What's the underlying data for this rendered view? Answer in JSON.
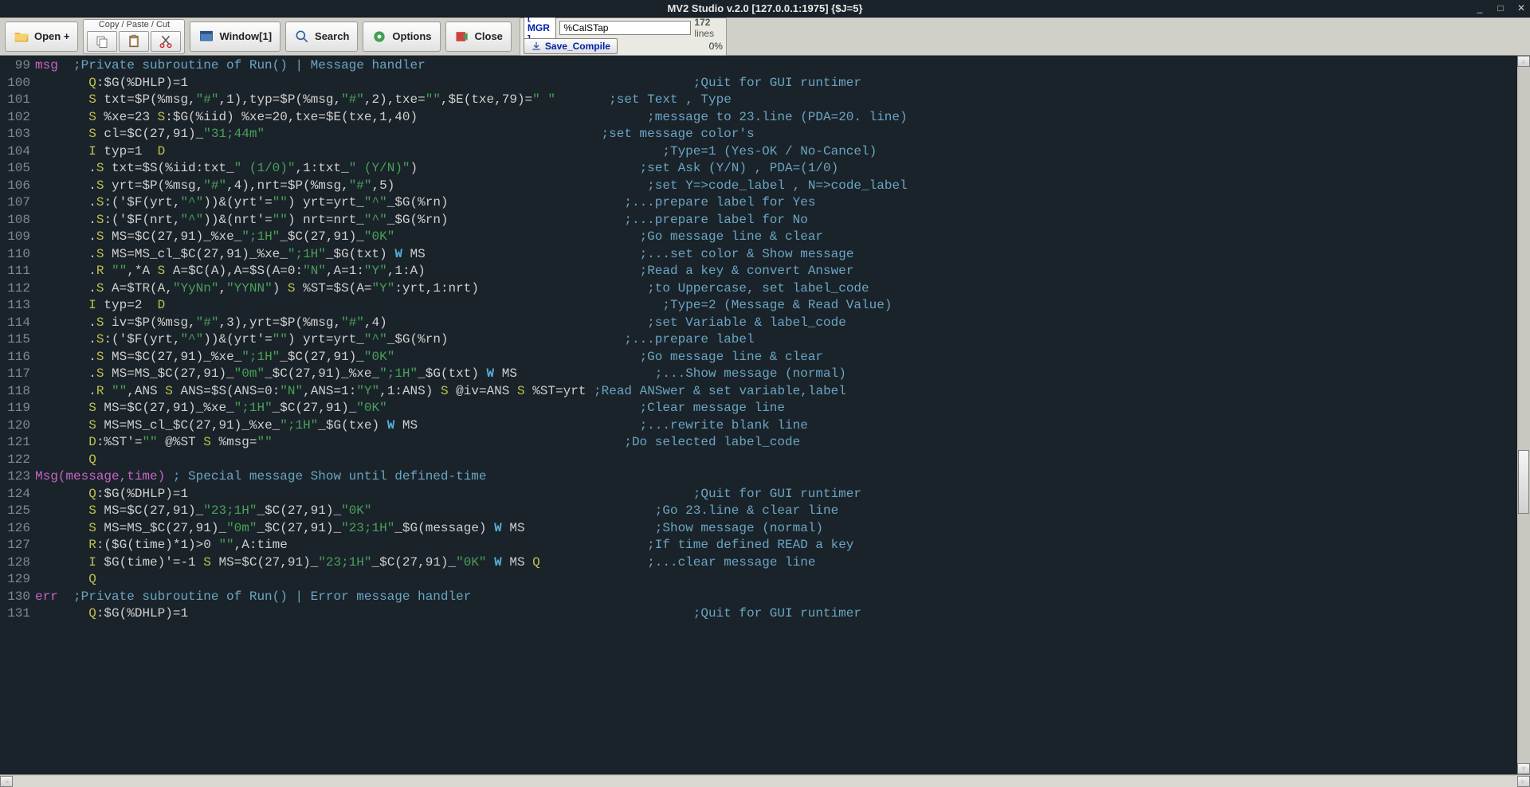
{
  "title": "MV2 Studio v.2.0 [127.0.0.1:1975] {$J=5}",
  "sysbtns": {
    "min": "_",
    "max": "□",
    "close": "✕"
  },
  "toolbar": {
    "open": "Open +",
    "cp_label": "Copy / Paste / Cut",
    "window": "Window[1]",
    "search": "Search",
    "options": "Options",
    "close": "Close"
  },
  "side": {
    "namespace": "[ MGR   ]",
    "filename": "%CalSTap",
    "lines": "172",
    "lines_suffix": "lines",
    "save": "Save_Compile",
    "progress": "0%"
  },
  "code": [
    {
      "n": "99",
      "label": "msg",
      "pad": "  ",
      "body": [
        [
          "comment",
          ";Private subroutine of Run() | Message handler"
        ]
      ]
    },
    {
      "n": "100",
      "pad": "       ",
      "body": [
        [
          "cmd",
          "Q"
        ],
        [
          "plain",
          ":$G(%DHLP)=1"
        ]
      ],
      "cpad": "                                                                  ",
      "c": ";Quit for GUI runtimer"
    },
    {
      "n": "101",
      "pad": "       ",
      "body": [
        [
          "cmd",
          "S"
        ],
        [
          "plain",
          " txt=$P(%msg,"
        ],
        [
          "str",
          "\"#\""
        ],
        [
          "plain",
          ",1),typ=$P(%msg,"
        ],
        [
          "str",
          "\"#\""
        ],
        [
          "plain",
          ",2),txe="
        ],
        [
          "str",
          "\"\""
        ],
        [
          "plain",
          ",$E(txe,79)="
        ],
        [
          "str",
          "\" \""
        ]
      ],
      "cpad": "       ",
      "c": ";set Text , Type"
    },
    {
      "n": "102",
      "pad": "       ",
      "body": [
        [
          "cmd",
          "S"
        ],
        [
          "plain",
          " %xe=23 "
        ],
        [
          "cmd",
          "S"
        ],
        [
          "plain",
          ":$G(%iid) %xe=20,txe=$E(txe,1,40)"
        ]
      ],
      "cpad": "                              ",
      "c": ";message to 23.line (PDA=20. line)"
    },
    {
      "n": "103",
      "pad": "       ",
      "body": [
        [
          "cmd",
          "S"
        ],
        [
          "plain",
          " cl=$C(27,91)_"
        ],
        [
          "str",
          "\"31;44m\""
        ]
      ],
      "cpad": "                                            ",
      "c": ";set message color's"
    },
    {
      "n": "104",
      "pad": "       ",
      "body": [
        [
          "cmd",
          "I"
        ],
        [
          "plain",
          " typ=1  "
        ],
        [
          "cmd",
          "D"
        ]
      ],
      "cpad": "                                                                 ",
      "c": ";Type=1 (Yes-OK / No-Cancel)"
    },
    {
      "n": "105",
      "pad": "       ",
      "body": [
        [
          "plain",
          "."
        ],
        [
          "cmd",
          "S"
        ],
        [
          "plain",
          " txt=$S(%iid:txt_"
        ],
        [
          "str",
          "\" (1/0)\""
        ],
        [
          "plain",
          ",1:txt_"
        ],
        [
          "str",
          "\" (Y/N)\""
        ],
        [
          "plain",
          ")"
        ]
      ],
      "cpad": "                             ",
      "c": ";set Ask (Y/N) , PDA=(1/0)"
    },
    {
      "n": "106",
      "pad": "       ",
      "body": [
        [
          "plain",
          "."
        ],
        [
          "cmd",
          "S"
        ],
        [
          "plain",
          " yrt=$P(%msg,"
        ],
        [
          "str",
          "\"#\""
        ],
        [
          "plain",
          ",4),nrt=$P(%msg,"
        ],
        [
          "str",
          "\"#\""
        ],
        [
          "plain",
          ",5)"
        ]
      ],
      "cpad": "                                 ",
      "c": ";set Y=>code_label , N=>code_label"
    },
    {
      "n": "107",
      "pad": "       ",
      "body": [
        [
          "plain",
          "."
        ],
        [
          "cmd",
          "S"
        ],
        [
          "plain",
          ":('$F(yrt,"
        ],
        [
          "str",
          "\"^\""
        ],
        [
          "plain",
          "))&(yrt'="
        ],
        [
          "str",
          "\"\""
        ],
        [
          "plain",
          ") yrt=yrt_"
        ],
        [
          "str",
          "\"^\""
        ],
        [
          "plain",
          "_$G(%rn)"
        ]
      ],
      "cpad": "                       ",
      "c": ";...prepare label for Yes"
    },
    {
      "n": "108",
      "pad": "       ",
      "body": [
        [
          "plain",
          "."
        ],
        [
          "cmd",
          "S"
        ],
        [
          "plain",
          ":('$F(nrt,"
        ],
        [
          "str",
          "\"^\""
        ],
        [
          "plain",
          "))&(nrt'="
        ],
        [
          "str",
          "\"\""
        ],
        [
          "plain",
          ") nrt=nrt_"
        ],
        [
          "str",
          "\"^\""
        ],
        [
          "plain",
          "_$G(%rn)"
        ]
      ],
      "cpad": "                       ",
      "c": ";...prepare label for No"
    },
    {
      "n": "109",
      "pad": "       ",
      "body": [
        [
          "plain",
          "."
        ],
        [
          "cmd",
          "S"
        ],
        [
          "plain",
          " MS=$C(27,91)_%xe_"
        ],
        [
          "str",
          "\";1H\""
        ],
        [
          "plain",
          "_$C(27,91)_"
        ],
        [
          "str",
          "\"0K\""
        ]
      ],
      "cpad": "                                ",
      "c": ";Go message line & clear"
    },
    {
      "n": "110",
      "pad": "       ",
      "body": [
        [
          "plain",
          "."
        ],
        [
          "cmd",
          "S"
        ],
        [
          "plain",
          " MS=MS_cl_$C(27,91)_%xe_"
        ],
        [
          "str",
          "\";1H\""
        ],
        [
          "plain",
          "_$G(txt) "
        ],
        [
          "w",
          "W"
        ],
        [
          "plain",
          " MS"
        ]
      ],
      "cpad": "                            ",
      "c": ";...set color & Show message"
    },
    {
      "n": "111",
      "pad": "       ",
      "body": [
        [
          "plain",
          "."
        ],
        [
          "cmd",
          "R"
        ],
        [
          "plain",
          " "
        ],
        [
          "str",
          "\"\""
        ],
        [
          "plain",
          ",*A "
        ],
        [
          "cmd",
          "S"
        ],
        [
          "plain",
          " A=$C(A),A=$S(A=0:"
        ],
        [
          "str",
          "\"N\""
        ],
        [
          "plain",
          ",A=1:"
        ],
        [
          "str",
          "\"Y\""
        ],
        [
          "plain",
          ",1:A)"
        ]
      ],
      "cpad": "                            ",
      "c": ";Read a key & convert Answer"
    },
    {
      "n": "112",
      "pad": "       ",
      "body": [
        [
          "plain",
          "."
        ],
        [
          "cmd",
          "S"
        ],
        [
          "plain",
          " A=$TR(A,"
        ],
        [
          "str",
          "\"YyNn\""
        ],
        [
          "plain",
          ","
        ],
        [
          "str",
          "\"YYNN\""
        ],
        [
          "plain",
          ") "
        ],
        [
          "cmd",
          "S"
        ],
        [
          "plain",
          " %ST=$S(A="
        ],
        [
          "str",
          "\"Y\""
        ],
        [
          "plain",
          ":yrt,1:nrt)"
        ]
      ],
      "cpad": "                      ",
      "c": ";to Uppercase, set label_code"
    },
    {
      "n": "113",
      "pad": "       ",
      "body": [
        [
          "cmd",
          "I"
        ],
        [
          "plain",
          " typ=2  "
        ],
        [
          "cmd",
          "D"
        ]
      ],
      "cpad": "                                                                 ",
      "c": ";Type=2 (Message & Read Value)"
    },
    {
      "n": "114",
      "pad": "       ",
      "body": [
        [
          "plain",
          "."
        ],
        [
          "cmd",
          "S"
        ],
        [
          "plain",
          " iv=$P(%msg,"
        ],
        [
          "str",
          "\"#\""
        ],
        [
          "plain",
          ",3),yrt=$P(%msg,"
        ],
        [
          "str",
          "\"#\""
        ],
        [
          "plain",
          ",4)"
        ]
      ],
      "cpad": "                                  ",
      "c": ";set Variable & label_code"
    },
    {
      "n": "115",
      "pad": "       ",
      "body": [
        [
          "plain",
          "."
        ],
        [
          "cmd",
          "S"
        ],
        [
          "plain",
          ":('$F(yrt,"
        ],
        [
          "str",
          "\"^\""
        ],
        [
          "plain",
          "))&(yrt'="
        ],
        [
          "str",
          "\"\""
        ],
        [
          "plain",
          ") yrt=yrt_"
        ],
        [
          "str",
          "\"^\""
        ],
        [
          "plain",
          "_$G(%rn)"
        ]
      ],
      "cpad": "                       ",
      "c": ";...prepare label"
    },
    {
      "n": "116",
      "pad": "       ",
      "body": [
        [
          "plain",
          "."
        ],
        [
          "cmd",
          "S"
        ],
        [
          "plain",
          " MS=$C(27,91)_%xe_"
        ],
        [
          "str",
          "\";1H\""
        ],
        [
          "plain",
          "_$C(27,91)_"
        ],
        [
          "str",
          "\"0K\""
        ]
      ],
      "cpad": "                                ",
      "c": ";Go message line & clear"
    },
    {
      "n": "117",
      "pad": "       ",
      "body": [
        [
          "plain",
          "."
        ],
        [
          "cmd",
          "S"
        ],
        [
          "plain",
          " MS=MS_$C(27,91)_"
        ],
        [
          "str",
          "\"0m\""
        ],
        [
          "plain",
          "_$C(27,91)_%xe_"
        ],
        [
          "str",
          "\";1H\""
        ],
        [
          "plain",
          "_$G(txt) "
        ],
        [
          "w",
          "W"
        ],
        [
          "plain",
          " MS"
        ]
      ],
      "cpad": "                  ",
      "c": ";...Show message (normal)"
    },
    {
      "n": "118",
      "pad": "       ",
      "body": [
        [
          "plain",
          "."
        ],
        [
          "cmd",
          "R"
        ],
        [
          "plain",
          " "
        ],
        [
          "str",
          "\"\""
        ],
        [
          "plain",
          ",ANS "
        ],
        [
          "cmd",
          "S"
        ],
        [
          "plain",
          " ANS=$S(ANS=0:"
        ],
        [
          "str",
          "\"N\""
        ],
        [
          "plain",
          ",ANS=1:"
        ],
        [
          "str",
          "\"Y\""
        ],
        [
          "plain",
          ",1:ANS) "
        ],
        [
          "cmd",
          "S"
        ],
        [
          "plain",
          " @iv=ANS "
        ],
        [
          "cmd",
          "S"
        ],
        [
          "plain",
          " %ST=yrt"
        ]
      ],
      "cpad": " ",
      "c": ";Read ANSwer & set variable,label"
    },
    {
      "n": "119",
      "pad": "       ",
      "body": [
        [
          "cmd",
          "S"
        ],
        [
          "plain",
          " MS=$C(27,91)_%xe_"
        ],
        [
          "str",
          "\";1H\""
        ],
        [
          "plain",
          "_$C(27,91)_"
        ],
        [
          "str",
          "\"0K\""
        ]
      ],
      "cpad": "                                 ",
      "c": ";Clear message line"
    },
    {
      "n": "120",
      "pad": "       ",
      "body": [
        [
          "cmd",
          "S"
        ],
        [
          "plain",
          " MS=MS_cl_$C(27,91)_%xe_"
        ],
        [
          "str",
          "\";1H\""
        ],
        [
          "plain",
          "_$G(txe) "
        ],
        [
          "w",
          "W"
        ],
        [
          "plain",
          " MS"
        ]
      ],
      "cpad": "                             ",
      "c": ";...rewrite blank line"
    },
    {
      "n": "121",
      "pad": "       ",
      "body": [
        [
          "cmd",
          "D"
        ],
        [
          "plain",
          ":%ST'="
        ],
        [
          "str",
          "\"\""
        ],
        [
          "plain",
          " @%ST "
        ],
        [
          "cmd",
          "S"
        ],
        [
          "plain",
          " %msg="
        ],
        [
          "str",
          "\"\""
        ]
      ],
      "cpad": "                                              ",
      "c": ";Do selected label_code"
    },
    {
      "n": "122",
      "pad": "       ",
      "body": [
        [
          "cmd",
          "Q"
        ]
      ]
    },
    {
      "n": "123",
      "label": "Msg",
      "args": "(message,time)",
      "pad": " ",
      "body": [
        [
          "comment",
          "; Special message Show until defined-time"
        ]
      ]
    },
    {
      "n": "124",
      "pad": "       ",
      "body": [
        [
          "cmd",
          "Q"
        ],
        [
          "plain",
          ":$G(%DHLP)=1"
        ]
      ],
      "cpad": "                                                                  ",
      "c": ";Quit for GUI runtimer"
    },
    {
      "n": "125",
      "pad": "       ",
      "body": [
        [
          "cmd",
          "S"
        ],
        [
          "plain",
          " MS=$C(27,91)_"
        ],
        [
          "str",
          "\"23;1H\""
        ],
        [
          "plain",
          "_$C(27,91)_"
        ],
        [
          "str",
          "\"0K\""
        ]
      ],
      "cpad": "                                     ",
      "c": ";Go 23.line & clear line"
    },
    {
      "n": "126",
      "pad": "       ",
      "body": [
        [
          "cmd",
          "S"
        ],
        [
          "plain",
          " MS=MS_$C(27,91)_"
        ],
        [
          "str",
          "\"0m\""
        ],
        [
          "plain",
          "_$C(27,91)_"
        ],
        [
          "str",
          "\"23;1H\""
        ],
        [
          "plain",
          "_$G(message) "
        ],
        [
          "w",
          "W"
        ],
        [
          "plain",
          " MS"
        ]
      ],
      "cpad": "                 ",
      "c": ";Show message (normal)"
    },
    {
      "n": "127",
      "pad": "       ",
      "body": [
        [
          "cmd",
          "R"
        ],
        [
          "plain",
          ":($G(time)*1)>0 "
        ],
        [
          "str",
          "\"\""
        ],
        [
          "plain",
          ",A:time"
        ]
      ],
      "cpad": "                                               ",
      "c": ";If time defined READ a key"
    },
    {
      "n": "128",
      "pad": "       ",
      "body": [
        [
          "cmd",
          "I"
        ],
        [
          "plain",
          " $G(time)'=-1 "
        ],
        [
          "cmd",
          "S"
        ],
        [
          "plain",
          " MS=$C(27,91)_"
        ],
        [
          "str",
          "\"23;1H\""
        ],
        [
          "plain",
          "_$C(27,91)_"
        ],
        [
          "str",
          "\"0K\""
        ],
        [
          "plain",
          " "
        ],
        [
          "w",
          "W"
        ],
        [
          "plain",
          " MS "
        ],
        [
          "cmd",
          "Q"
        ]
      ],
      "cpad": "              ",
      "c": ";...clear message line"
    },
    {
      "n": "129",
      "pad": "       ",
      "body": [
        [
          "cmd",
          "Q"
        ]
      ]
    },
    {
      "n": "130",
      "label": "err",
      "pad": "  ",
      "body": [
        [
          "comment",
          ";Private subroutine of Run() | Error message handler"
        ]
      ]
    },
    {
      "n": "131",
      "pad": "       ",
      "body": [
        [
          "cmd",
          "Q"
        ],
        [
          "plain",
          ":$G(%DHLP)=1"
        ]
      ],
      "cpad": "                                                                  ",
      "c": ";Quit for GUI runtimer"
    }
  ]
}
